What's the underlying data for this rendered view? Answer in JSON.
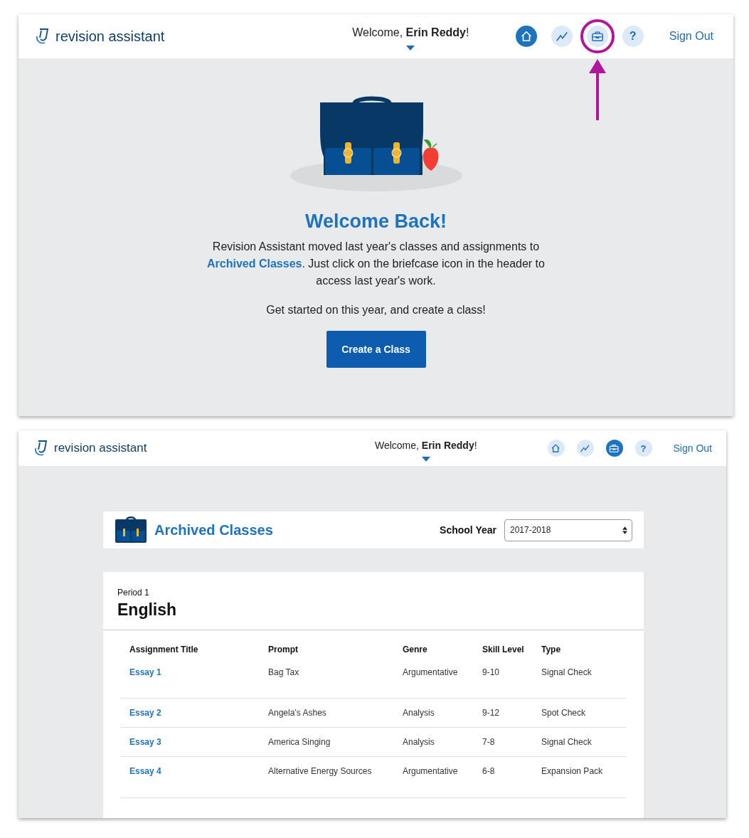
{
  "panels": [
    {
      "kind": "welcome",
      "header": {
        "logo": "revision assistant",
        "greeting": "Welcome, ",
        "user": "Erin Reddy",
        "greeting_end": "!",
        "nav": [
          {
            "kind": "home",
            "selected": true,
            "highlighted": false
          },
          {
            "kind": "progress",
            "selected": false,
            "highlighted": false
          },
          {
            "kind": "archive",
            "selected": false,
            "highlighted": true
          },
          {
            "kind": "help",
            "label": "?",
            "selected": false,
            "highlighted": false
          }
        ],
        "sign_out": "Sign Out"
      },
      "title": "Welcome Back!",
      "message_before": "Revision Assistant moved last year's classes and assignments to",
      "message_link": "Archived Classes",
      "message_after": ". Just click on the briefcase icon in the header to access last year's work.",
      "prompt": "Get started on this year, and create a class!",
      "button": "Create a Class"
    },
    {
      "kind": "archive",
      "header": {
        "logo": "revision assistant",
        "greeting": "Welcome, ",
        "user": "Erin Reddy",
        "greeting_end": "!",
        "nav": [
          {
            "kind": "home",
            "selected": false,
            "highlighted": false
          },
          {
            "kind": "progress",
            "selected": false,
            "highlighted": false
          },
          {
            "kind": "archive",
            "selected": true,
            "highlighted": false
          },
          {
            "kind": "help",
            "label": "?",
            "selected": false,
            "highlighted": false
          }
        ],
        "sign_out": "Sign Out"
      },
      "title": "Archived Classes",
      "year_label": "School Year",
      "year_value": "2017-2018",
      "class": {
        "period": "Period 1",
        "name": "English",
        "columns": [
          "Assignment Title",
          "Prompt",
          "Genre",
          "Skill Level",
          "Type"
        ],
        "rows": [
          {
            "title": "Essay 1",
            "prompt": "Bag Tax",
            "genre": "Argumentative",
            "skill": "9-10",
            "type": "Signal Check"
          },
          {
            "title": "Essay 2",
            "prompt": "Angela’s Ashes",
            "genre": "Analysis",
            "skill": "9-12",
            "type": "Spot Check"
          },
          {
            "title": "Essay 3",
            "prompt": "America Singing",
            "genre": "Analysis",
            "skill": "7-8",
            "type": "Signal Check"
          },
          {
            "title": "Essay 4",
            "prompt": "Alternative Energy Sources",
            "genre": "Argumentative",
            "skill": "6-8",
            "type": "Expansion Pack"
          }
        ]
      }
    }
  ]
}
